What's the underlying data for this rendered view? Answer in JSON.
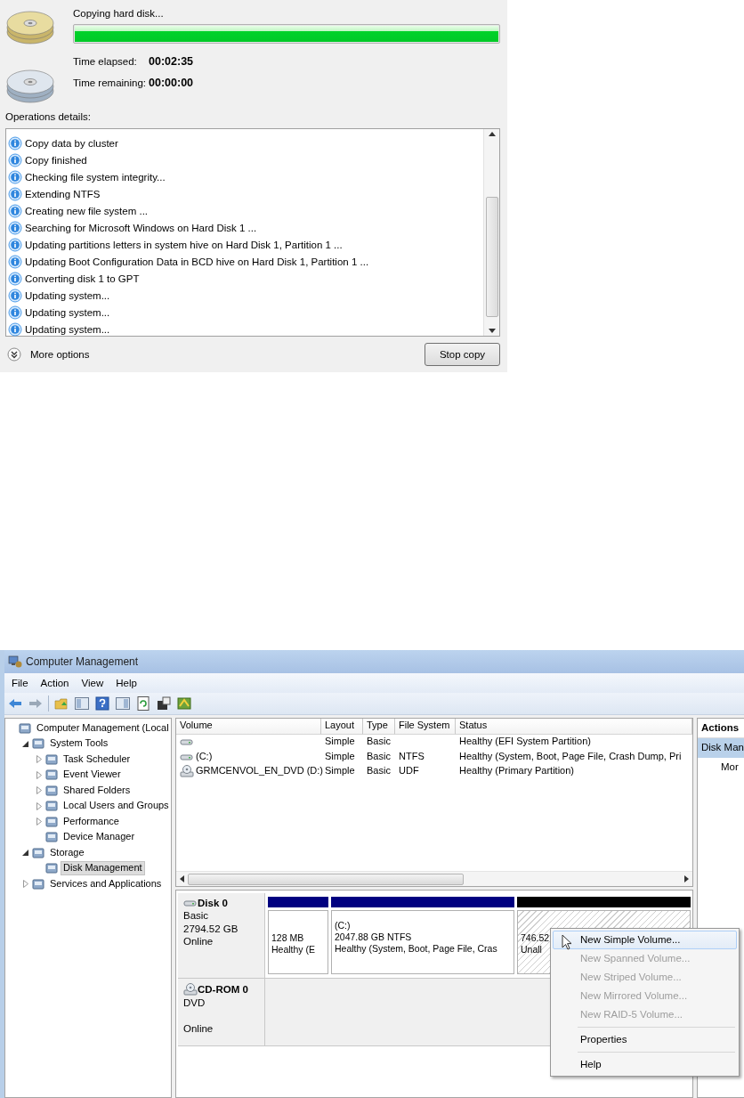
{
  "copy_panel": {
    "status": "Copying hard disk...",
    "progress": {
      "level": 1.0
    },
    "elapsed_label": "Time elapsed:",
    "elapsed": "00:02:35",
    "remaining_label": "Time remaining:",
    "remaining": "00:00:00",
    "details_label": "Operations details:",
    "log": [
      "Copy data by cluster",
      "Copy finished",
      "Checking file system integrity...",
      "Extending NTFS",
      "Creating new file system ...",
      "Searching for Microsoft Windows on Hard Disk 1 ...",
      "Updating partitions letters in system hive on Hard Disk 1, Partition 1 ...",
      "Updating Boot Configuration Data in BCD hive on Hard Disk 1, Partition 1 ...",
      "Converting disk 1 to GPT",
      "Updating system...",
      "Updating system...",
      "Updating system..."
    ],
    "more_options": "More options",
    "stop_button": "Stop copy"
  },
  "window": {
    "title": "Computer Management",
    "menu": [
      "File",
      "Action",
      "View",
      "Help"
    ],
    "tree": [
      {
        "label": "Computer Management (Local",
        "selected": false,
        "children": [
          {
            "label": "System Tools",
            "selected": false,
            "expanded": true,
            "children": [
              {
                "label": "Task Scheduler",
                "selected": false,
                "expanded": false
              },
              {
                "label": "Event Viewer",
                "selected": false,
                "expanded": false
              },
              {
                "label": "Shared Folders",
                "selected": false,
                "expanded": false
              },
              {
                "label": "Local Users and Groups",
                "selected": false,
                "expanded": false
              },
              {
                "label": "Performance",
                "selected": false,
                "expanded": false
              },
              {
                "label": "Device Manager",
                "selected": false
              }
            ]
          },
          {
            "label": "Storage",
            "selected": false,
            "expanded": true,
            "children": [
              {
                "label": "Disk Management",
                "selected": true
              }
            ]
          },
          {
            "label": "Services and Applications",
            "selected": false,
            "expanded": false
          }
        ]
      }
    ],
    "volumes": {
      "columns": [
        "Volume",
        "Layout",
        "Type",
        "File System",
        "Status"
      ],
      "rows": [
        {
          "kind": "disk",
          "layout": "Simple",
          "type": "Basic",
          "status": "Healthy (EFI System Partition)"
        },
        {
          "kind": "disk",
          "volume": "(C:)",
          "layout": "Simple",
          "type": "Basic",
          "file_system": "NTFS",
          "status": "Healthy (System, Boot, Page File, Crash Dump, Pri"
        },
        {
          "kind": "dvd",
          "volume": "GRMCENVOL_EN_DVD (D:)",
          "layout": "Simple",
          "type": "Basic",
          "file_system": "UDF",
          "status": "Healthy (Primary Partition)"
        }
      ]
    },
    "disks": [
      {
        "kind": "disk",
        "name": "Disk 0",
        "type": "Basic",
        "size": "2794.52 GB",
        "status": "Online",
        "partitions": [
          {
            "color": "#000080",
            "unallocated": false,
            "lines": [
              "128 MB",
              "Healthy (E"
            ]
          },
          {
            "color": "#000080",
            "unallocated": false,
            "lines": [
              "(C:)",
              "2047.88 GB NTFS",
              "Healthy (System, Boot, Page File, Cras"
            ]
          },
          {
            "color": "#000000",
            "unallocated": true,
            "lines": [
              "746.52",
              "Unall"
            ]
          }
        ]
      },
      {
        "kind": "dvd",
        "name": "CD-ROM 0",
        "type": "DVD",
        "status": "Online"
      }
    ],
    "actions": {
      "title": "Actions",
      "items": [
        {
          "label": "Disk Man",
          "selected": true
        },
        {
          "label": "Mor",
          "selected": false
        }
      ]
    },
    "context_menu": {
      "groups": [
        [
          {
            "label": "New Simple Volume...",
            "selected": true,
            "disabled": false
          },
          {
            "label": "New Spanned Volume...",
            "selected": false,
            "disabled": true
          },
          {
            "label": "New Striped Volume...",
            "selected": false,
            "disabled": true
          },
          {
            "label": "New Mirrored Volume...",
            "selected": false,
            "disabled": true
          },
          {
            "label": "New RAID-5 Volume...",
            "selected": false,
            "disabled": true
          }
        ],
        [
          {
            "label": "Properties",
            "selected": false,
            "disabled": false
          }
        ],
        [
          {
            "label": "Help",
            "selected": false,
            "disabled": false
          }
        ]
      ]
    }
  }
}
